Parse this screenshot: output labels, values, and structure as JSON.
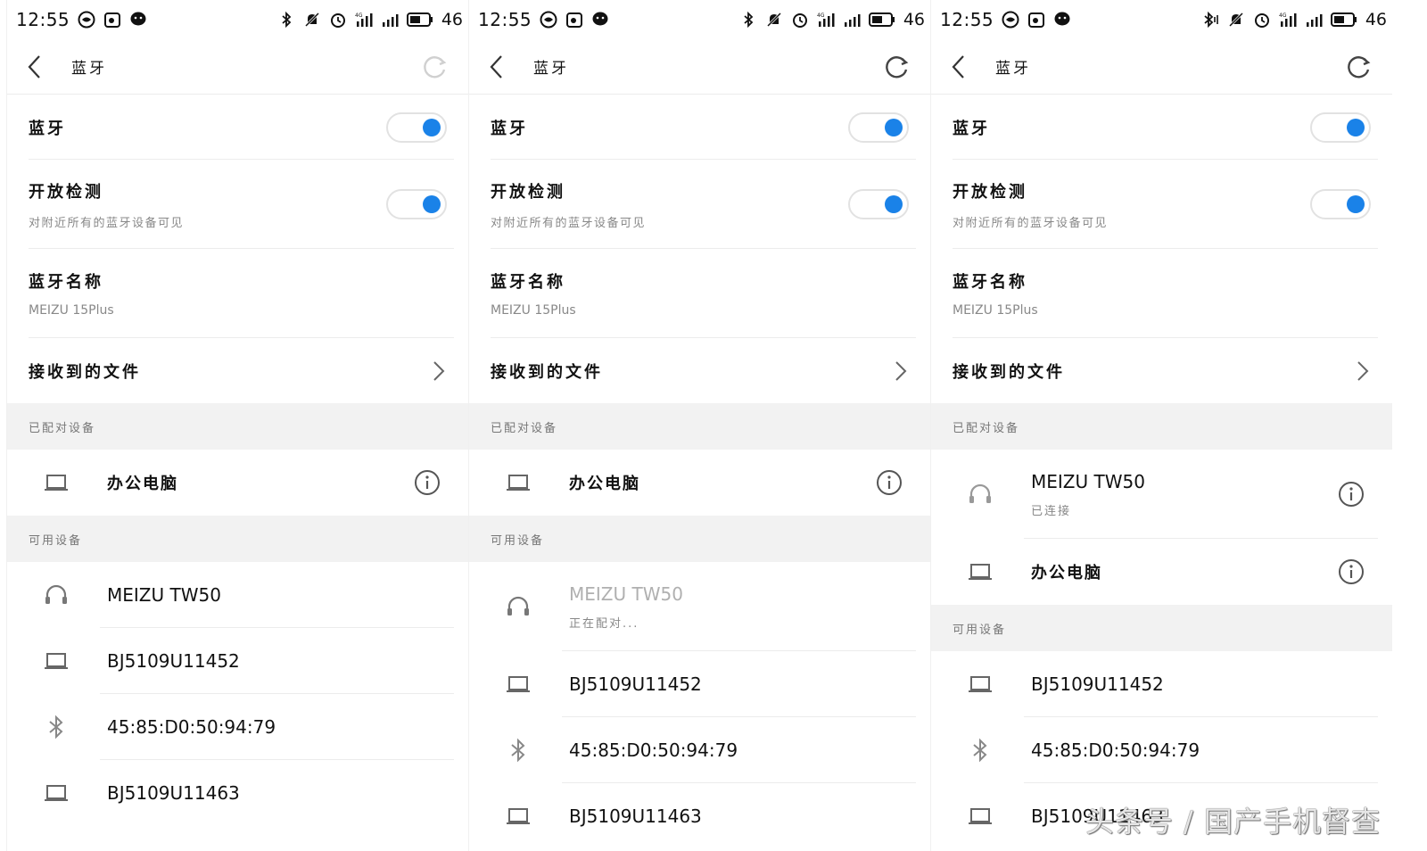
{
  "status": {
    "time": "12:55",
    "battery": "46"
  },
  "header": {
    "title": "蓝牙"
  },
  "settings": {
    "bluetooth_label": "蓝牙",
    "discovery_label": "开放检测",
    "discovery_sub": "对附近所有的蓝牙设备可见",
    "name_label": "蓝牙名称",
    "name_value": "MEIZU 15Plus",
    "received_label": "接收到的文件"
  },
  "sections": {
    "paired": "已配对设备",
    "available": "可用设备"
  },
  "devices": {
    "office_pc": "办公电脑",
    "tw50": "MEIZU TW50",
    "bj1": "BJ5109U11452",
    "mac": "45:85:D0:50:94:79",
    "bj2": "BJ5109U11463"
  },
  "states": {
    "pairing": "正在配对...",
    "connected": "已连接"
  },
  "watermark": "头条号 / 国产手机督查",
  "colors": {
    "accent": "#1a82e8",
    "section_bg": "#f2f2f2",
    "divider": "#ececec"
  }
}
